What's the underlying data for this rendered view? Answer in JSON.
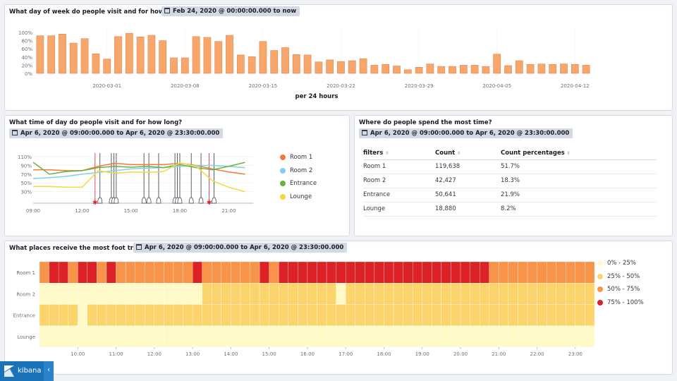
{
  "panel1": {
    "title": "What day of week do people visit and for how long?",
    "time_range": "Feb 24, 2020 @ 00:00:00.000 to now"
  },
  "panel2": {
    "title": "What time of day do people visit and for how long?",
    "time_range": "Apr 6, 2020 @ 09:00:00.000 to Apr 6, 2020 @ 23:30:00.000"
  },
  "panel3": {
    "title": "Where do people spend the most time?",
    "time_range": "Apr 6, 2020 @ 09:00:00.000 to Apr 6, 2020 @ 23:30:00.000",
    "columns": [
      "filters",
      "Count",
      "Count percentages"
    ],
    "rows": [
      [
        "Room 1",
        "119,638",
        "51.7%"
      ],
      [
        "Room 2",
        "42,427",
        "18.3%"
      ],
      [
        "Entrance",
        "50,641",
        "21.9%"
      ],
      [
        "Lounge",
        "18,880",
        "8.2%"
      ]
    ]
  },
  "panel4": {
    "title": "What places receive the most foot traffic?",
    "time_range": "Apr 6, 2020 @ 09:00:00.000 to Apr 6, 2020 @ 23:30:00.000"
  },
  "brand": {
    "name": "kibana",
    "collapse_icon": "‹"
  },
  "colors": {
    "bar_fill": "#f7a76c",
    "bar_stroke": "#e8834a",
    "room1": "#f5773a",
    "room2": "#7fcff0",
    "entrance": "#6ab23b",
    "lounge": "#f5d83a",
    "h0": "#fffac8",
    "h1": "#fcd46c",
    "h2": "#f7944a",
    "h3": "#dc2127"
  },
  "chart_data": [
    {
      "type": "bar",
      "title": "",
      "xlabel": "per 24 hours",
      "ylabel": "",
      "ylim": [
        0,
        100
      ],
      "y_ticks": [
        "0%",
        "20%",
        "40%",
        "60%",
        "80%",
        "100%"
      ],
      "x_ticks": [
        "2020-03-01",
        "2020-03-08",
        "2020-03-15",
        "2020-03-22",
        "2020-03-29",
        "2020-04-05",
        "2020-04-12"
      ],
      "categories": [
        "2020-02-24",
        "2020-02-25",
        "2020-02-26",
        "2020-02-27",
        "2020-02-28",
        "2020-02-29",
        "2020-03-01",
        "2020-03-02",
        "2020-03-03",
        "2020-03-04",
        "2020-03-05",
        "2020-03-06",
        "2020-03-07",
        "2020-03-08",
        "2020-03-09",
        "2020-03-10",
        "2020-03-11",
        "2020-03-12",
        "2020-03-13",
        "2020-03-14",
        "2020-03-15",
        "2020-03-16",
        "2020-03-17",
        "2020-03-18",
        "2020-03-19",
        "2020-03-20",
        "2020-03-21",
        "2020-03-22",
        "2020-03-23",
        "2020-03-24",
        "2020-03-25",
        "2020-03-26",
        "2020-03-27",
        "2020-03-28",
        "2020-03-29",
        "2020-03-30",
        "2020-03-31",
        "2020-04-01",
        "2020-04-02",
        "2020-04-03",
        "2020-04-04",
        "2020-04-05",
        "2020-04-06",
        "2020-04-07",
        "2020-04-08",
        "2020-04-09",
        "2020-04-10",
        "2020-04-11",
        "2020-04-12",
        "2020-04-13"
      ],
      "values": [
        92,
        92,
        96,
        74,
        85,
        48,
        35,
        90,
        98,
        89,
        93,
        80,
        38,
        38,
        90,
        88,
        78,
        93,
        45,
        41,
        78,
        56,
        63,
        46,
        45,
        28,
        33,
        29,
        31,
        36,
        20,
        22,
        18,
        9,
        15,
        23,
        17,
        17,
        20,
        20,
        17,
        47,
        19,
        31,
        22,
        23,
        22,
        23,
        22,
        20
      ]
    },
    {
      "type": "line",
      "title": "",
      "xlabel": "",
      "ylabel": "",
      "ylim": [
        10,
        115
      ],
      "y_ticks": [
        "30%",
        "50%",
        "70%",
        "90%",
        "110%"
      ],
      "x_ticks": [
        "09:00",
        "12:00",
        "15:00",
        "18:00",
        "21:00"
      ],
      "x": [
        9,
        10,
        11,
        12,
        13,
        14,
        15,
        16,
        17,
        18,
        19,
        20,
        21,
        22
      ],
      "series": [
        {
          "name": "Room 1",
          "values": [
            80,
            80,
            78,
            78,
            88,
            95,
            92,
            92,
            92,
            95,
            90,
            82,
            75,
            70
          ]
        },
        {
          "name": "Room 2",
          "values": [
            60,
            62,
            65,
            70,
            74,
            78,
            82,
            84,
            85,
            88,
            90,
            90,
            88,
            85
          ]
        },
        {
          "name": "Entrance",
          "values": [
            97,
            70,
            76,
            78,
            85,
            88,
            86,
            88,
            85,
            92,
            85,
            80,
            88,
            97
          ]
        },
        {
          "name": "Lounge",
          "values": [
            42,
            42,
            40,
            40,
            78,
            72,
            75,
            74,
            76,
            96,
            88,
            55,
            40,
            30
          ]
        }
      ],
      "annotations": [
        {
          "x": 12.8,
          "kind": "alert"
        },
        {
          "x": 13.1,
          "kind": "bell"
        },
        {
          "x": 13.8,
          "kind": "bell"
        },
        {
          "x": 13.95,
          "kind": "bell"
        },
        {
          "x": 14.1,
          "kind": "bell"
        },
        {
          "x": 15.8,
          "kind": "bell"
        },
        {
          "x": 16.1,
          "kind": "bell"
        },
        {
          "x": 16.7,
          "kind": "bell"
        },
        {
          "x": 17.7,
          "kind": "bell"
        },
        {
          "x": 17.85,
          "kind": "bell"
        },
        {
          "x": 18.0,
          "kind": "bell"
        },
        {
          "x": 18.7,
          "kind": "bell"
        },
        {
          "x": 19.3,
          "kind": "bell"
        },
        {
          "x": 19.8,
          "kind": "alert"
        },
        {
          "x": 20.1,
          "kind": "bell"
        }
      ],
      "legend_position": "right"
    },
    {
      "type": "heatmap",
      "title": "",
      "rows": [
        "Room 1",
        "Room 2",
        "Entrance",
        "Lounge"
      ],
      "x_ticks": [
        "10:00",
        "11:00",
        "12:00",
        "13:00",
        "14:00",
        "15:00",
        "16:00",
        "17:00",
        "18:00",
        "19:00",
        "20:00",
        "21:00",
        "22:00",
        "23:00"
      ],
      "x_start": "09:00",
      "interval_minutes": 15,
      "legend": [
        "0% - 25%",
        "25% - 50%",
        "50% - 75%",
        "75% - 100%"
      ],
      "levels": [
        [
          2,
          3,
          3,
          2,
          3,
          3,
          2,
          3,
          2,
          2,
          2,
          2,
          2,
          2,
          2,
          2,
          3,
          2,
          2,
          2,
          2,
          2,
          2,
          3,
          2,
          3,
          3,
          3,
          3,
          3,
          3,
          3,
          3,
          3,
          3,
          3,
          3,
          3,
          3,
          3,
          3,
          3,
          3,
          3,
          3,
          3,
          3,
          2,
          2,
          2,
          2,
          2,
          2,
          2,
          2,
          2,
          2,
          2
        ],
        [
          0,
          0,
          0,
          0,
          0,
          0,
          0,
          0,
          0,
          0,
          0,
          0,
          0,
          0,
          0,
          0,
          0,
          1,
          1,
          1,
          1,
          1,
          1,
          1,
          1,
          1,
          1,
          1,
          1,
          1,
          1,
          0,
          1,
          1,
          1,
          1,
          1,
          1,
          1,
          1,
          1,
          1,
          1,
          1,
          1,
          1,
          1,
          1,
          1,
          1,
          1,
          1,
          1,
          1,
          1,
          1,
          1,
          1
        ],
        [
          1,
          1,
          1,
          1,
          0,
          1,
          1,
          1,
          1,
          1,
          1,
          1,
          1,
          1,
          1,
          1,
          1,
          1,
          1,
          1,
          1,
          1,
          1,
          1,
          1,
          1,
          1,
          1,
          1,
          1,
          1,
          1,
          1,
          1,
          1,
          1,
          1,
          1,
          1,
          1,
          1,
          1,
          1,
          1,
          1,
          1,
          1,
          1,
          1,
          1,
          1,
          1,
          1,
          1,
          1,
          1,
          1,
          1
        ],
        [
          0,
          0,
          0,
          0,
          0,
          0,
          0,
          0,
          0,
          0,
          0,
          0,
          0,
          0,
          0,
          0,
          0,
          0,
          0,
          0,
          0,
          0,
          0,
          0,
          0,
          0,
          0,
          0,
          0,
          0,
          0,
          0,
          0,
          0,
          0,
          0,
          0,
          0,
          0,
          0,
          0,
          0,
          0,
          0,
          0,
          0,
          0,
          0,
          0,
          0,
          0,
          0,
          0,
          0,
          0,
          0,
          0,
          0
        ]
      ],
      "legend_position": "right"
    }
  ]
}
